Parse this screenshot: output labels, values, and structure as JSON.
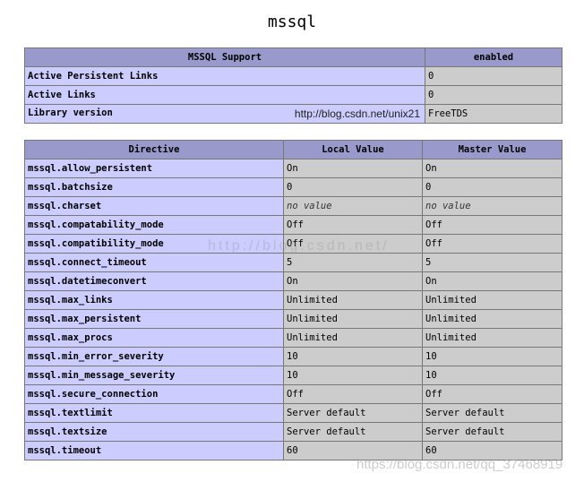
{
  "page": {
    "title": "mssql"
  },
  "support_table": {
    "headers": [
      "MSSQL Support",
      "enabled"
    ],
    "rows": [
      {
        "name": "Active Persistent Links",
        "value": "0"
      },
      {
        "name": "Active Links",
        "value": "0"
      },
      {
        "name": "Library version",
        "value": "FreeTDS"
      }
    ],
    "inline_watermark": "http://blog.csdn.net/unix21"
  },
  "directive_table": {
    "headers": [
      "Directive",
      "Local Value",
      "Master Value"
    ],
    "rows": [
      {
        "directive": "mssql.allow_persistent",
        "local": "On",
        "master": "On"
      },
      {
        "directive": "mssql.batchsize",
        "local": "0",
        "master": "0"
      },
      {
        "directive": "mssql.charset",
        "local": "no value",
        "master": "no value"
      },
      {
        "directive": "mssql.compatability_mode",
        "local": "Off",
        "master": "Off"
      },
      {
        "directive": "mssql.compatibility_mode",
        "local": "Off",
        "master": "Off"
      },
      {
        "directive": "mssql.connect_timeout",
        "local": "5",
        "master": "5"
      },
      {
        "directive": "mssql.datetimeconvert",
        "local": "On",
        "master": "On"
      },
      {
        "directive": "mssql.max_links",
        "local": "Unlimited",
        "master": "Unlimited"
      },
      {
        "directive": "mssql.max_persistent",
        "local": "Unlimited",
        "master": "Unlimited"
      },
      {
        "directive": "mssql.max_procs",
        "local": "Unlimited",
        "master": "Unlimited"
      },
      {
        "directive": "mssql.min_error_severity",
        "local": "10",
        "master": "10"
      },
      {
        "directive": "mssql.min_message_severity",
        "local": "10",
        "master": "10"
      },
      {
        "directive": "mssql.secure_connection",
        "local": "Off",
        "master": "Off"
      },
      {
        "directive": "mssql.textlimit",
        "local": "Server default",
        "master": "Server default"
      },
      {
        "directive": "mssql.textsize",
        "local": "Server default",
        "master": "Server default"
      },
      {
        "directive": "mssql.timeout",
        "local": "60",
        "master": "60"
      }
    ]
  },
  "watermarks": {
    "middle": "http://blog.csdn.net/",
    "bottom": "https://blog.csdn.net/qq_37468919"
  },
  "colors": {
    "header": "#9999cc",
    "label_cell": "#ccccff",
    "value_cell": "#cccccc"
  }
}
